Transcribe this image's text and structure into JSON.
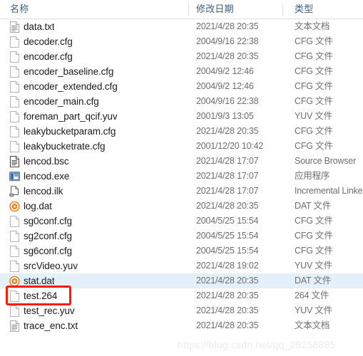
{
  "header": {
    "columns": [
      {
        "id": "name",
        "label": "名称"
      },
      {
        "id": "date",
        "label": "修改日期"
      },
      {
        "id": "type",
        "label": "类型"
      }
    ]
  },
  "colors": {
    "selection": "#e3f0fa",
    "annotation": "#fc1d0a",
    "header_text": "#3f5e7e",
    "name_text": "#1b1b1b",
    "meta_text": "#6e6e6e",
    "watermark": "#ececec",
    "dat_icon": "#f07c1a",
    "exe_icon": "#2b6cb9"
  },
  "files": [
    {
      "name": "data.txt",
      "date": "2021/4/28 20:35",
      "type": "文本文档",
      "icon": "text-document-icon",
      "selected": false,
      "annotated": false
    },
    {
      "name": "decoder.cfg",
      "date": "2004/9/16 22:38",
      "type": "CFG 文件",
      "icon": "blank-document-icon",
      "selected": false,
      "annotated": false
    },
    {
      "name": "encoder.cfg",
      "date": "2021/4/28 20:35",
      "type": "CFG 文件",
      "icon": "blank-document-icon",
      "selected": false,
      "annotated": false
    },
    {
      "name": "encoder_baseline.cfg",
      "date": "2004/9/2 12:46",
      "type": "CFG 文件",
      "icon": "blank-document-icon",
      "selected": false,
      "annotated": false
    },
    {
      "name": "encoder_extended.cfg",
      "date": "2004/9/2 12:46",
      "type": "CFG 文件",
      "icon": "blank-document-icon",
      "selected": false,
      "annotated": false
    },
    {
      "name": "encoder_main.cfg",
      "date": "2004/9/16 22:38",
      "type": "CFG 文件",
      "icon": "blank-document-icon",
      "selected": false,
      "annotated": false
    },
    {
      "name": "foreman_part_qcif.yuv",
      "date": "2001/9/3 13:05",
      "type": "YUV 文件",
      "icon": "blank-document-icon",
      "selected": false,
      "annotated": false
    },
    {
      "name": "leakybucketparam.cfg",
      "date": "2021/4/28 20:35",
      "type": "CFG 文件",
      "icon": "blank-document-icon",
      "selected": false,
      "annotated": false
    },
    {
      "name": "leakybucketrate.cfg",
      "date": "2001/12/20 10:42",
      "type": "CFG 文件",
      "icon": "blank-document-icon",
      "selected": false,
      "annotated": false
    },
    {
      "name": "lencod.bsc",
      "date": "2021/4/28 17:07",
      "type": "Source Browser",
      "icon": "source-browser-icon",
      "selected": false,
      "annotated": false
    },
    {
      "name": "lencod.exe",
      "date": "2021/4/28 17:07",
      "type": "应用程序",
      "icon": "application-icon",
      "selected": false,
      "annotated": false
    },
    {
      "name": "lencod.ilk",
      "date": "2021/4/28 17:07",
      "type": "Incremental Linker",
      "icon": "incremental-linker-icon",
      "selected": false,
      "annotated": false
    },
    {
      "name": "log.dat",
      "date": "2021/4/28 20:35",
      "type": "DAT 文件",
      "icon": "media-dat-icon",
      "selected": false,
      "annotated": false
    },
    {
      "name": "sg0conf.cfg",
      "date": "2004/5/25 15:54",
      "type": "CFG 文件",
      "icon": "blank-document-icon",
      "selected": false,
      "annotated": false
    },
    {
      "name": "sg2conf.cfg",
      "date": "2004/5/25 15:54",
      "type": "CFG 文件",
      "icon": "blank-document-icon",
      "selected": false,
      "annotated": false
    },
    {
      "name": "sg6conf.cfg",
      "date": "2004/5/25 15:54",
      "type": "CFG 文件",
      "icon": "blank-document-icon",
      "selected": false,
      "annotated": false
    },
    {
      "name": "srcVideo.yuv",
      "date": "2021/4/28 19:02",
      "type": "YUV 文件",
      "icon": "blank-document-icon",
      "selected": false,
      "annotated": false
    },
    {
      "name": "stat.dat",
      "date": "2021/4/28 20:35",
      "type": "DAT 文件",
      "icon": "media-dat-icon",
      "selected": true,
      "annotated": false
    },
    {
      "name": "test.264",
      "date": "2021/4/28 20:35",
      "type": "264 文件",
      "icon": "blank-document-icon",
      "selected": false,
      "annotated": true
    },
    {
      "name": "test_rec.yuv",
      "date": "2021/4/28 20:35",
      "type": "YUV 文件",
      "icon": "blank-document-icon",
      "selected": false,
      "annotated": false
    },
    {
      "name": "trace_enc.txt",
      "date": "2021/4/28 20:35",
      "type": "文本文档",
      "icon": "text-document-icon",
      "selected": false,
      "annotated": false
    }
  ],
  "watermark": {
    "text": "https://blog.csdn.net/qq_28258885"
  }
}
